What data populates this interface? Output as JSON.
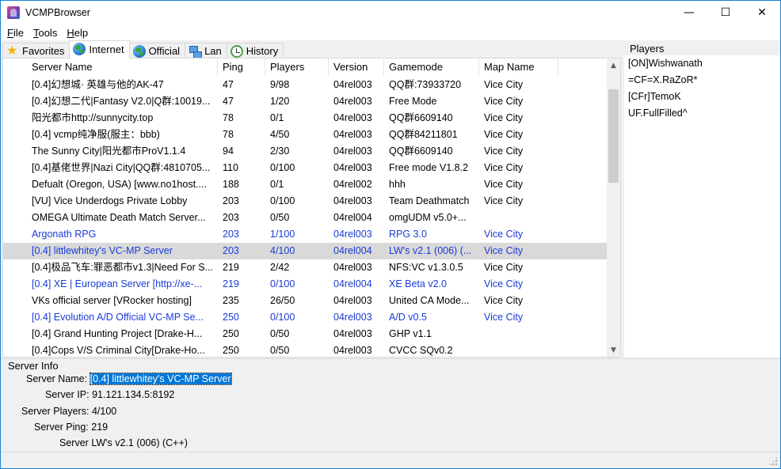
{
  "window": {
    "title": "VCMPBrowser",
    "controls": {
      "minimize": "—",
      "maximize": "☐",
      "close": "✕"
    }
  },
  "menu": {
    "items": [
      {
        "first": "F",
        "rest": "ile"
      },
      {
        "first": "T",
        "rest": "ools"
      },
      {
        "first": "H",
        "rest": "elp"
      }
    ]
  },
  "tabs": [
    {
      "label": "Favorites",
      "icon": "star-icon"
    },
    {
      "label": "Internet",
      "icon": "globe-icon",
      "active": true
    },
    {
      "label": "Official",
      "icon": "globe-icon"
    },
    {
      "label": "Lan",
      "icon": "lan-icon"
    },
    {
      "label": "History",
      "icon": "history-icon"
    }
  ],
  "server_list": {
    "columns": [
      "Server Name",
      "Ping",
      "Players",
      "Version",
      "Gamemode",
      "Map Name"
    ],
    "rows": [
      {
        "name": "[0.4]幻想城·      英雄与他的AK-47",
        "ping": "47",
        "players": "9/98",
        "version": "04rel003",
        "gamemode": "QQ群:73933720",
        "map": "Vice City",
        "blue": false
      },
      {
        "name": "[0.4]幻想二代|Fantasy V2.0|Q群:10019...",
        "ping": "47",
        "players": "1/20",
        "version": "04rel003",
        "gamemode": "Free Mode",
        "map": "Vice City",
        "blue": false
      },
      {
        "name": "阳光都市http://sunnycity.top",
        "ping": "78",
        "players": "0/1",
        "version": "04rel003",
        "gamemode": "QQ群6609140",
        "map": "Vice City",
        "blue": false
      },
      {
        "name": "[0.4] vcmp纯净服(服主：bbb)",
        "ping": "78",
        "players": "4/50",
        "version": "04rel003",
        "gamemode": "QQ群84211801",
        "map": "Vice City",
        "blue": false
      },
      {
        "name": "The Sunny City|阳光都市ProV1.1.4",
        "ping": "94",
        "players": "2/30",
        "version": "04rel003",
        "gamemode": "QQ群6609140",
        "map": "Vice City",
        "blue": false
      },
      {
        "name": "[0.4]基佬世界|Nazi City|QQ群:4810705...",
        "ping": "110",
        "players": "0/100",
        "version": "04rel003",
        "gamemode": "Free mode V1.8.2",
        "map": "Vice City",
        "blue": false
      },
      {
        "name": "Defualt (Oregon, USA) [www.no1host....",
        "ping": "188",
        "players": "0/1",
        "version": "04rel002",
        "gamemode": "hhh",
        "map": "Vice City",
        "blue": false
      },
      {
        "name": "[VU] Vice Underdogs Private Lobby",
        "ping": "203",
        "players": "0/100",
        "version": "04rel003",
        "gamemode": "Team Deathmatch",
        "map": "Vice City",
        "blue": false
      },
      {
        "name": "OMEGA Ultimate Death Match Server...",
        "ping": "203",
        "players": "0/50",
        "version": "04rel004",
        "gamemode": "omgUDM v5.0+...",
        "map": "",
        "blue": false
      },
      {
        "name": "Argonath RPG",
        "ping": "203",
        "players": "1/100",
        "version": "04rel003",
        "gamemode": "RPG 3.0",
        "map": "Vice City",
        "blue": true
      },
      {
        "name": "[0.4] littlewhitey's VC-MP Server",
        "ping": "203",
        "players": "4/100",
        "version": "04rel004",
        "gamemode": "LW's v2.1 (006) (...",
        "map": "Vice City",
        "blue": true,
        "selected": true
      },
      {
        "name": "[0.4]极品飞车:罪恶都市v1.3|Need For S...",
        "ping": "219",
        "players": "2/42",
        "version": "04rel003",
        "gamemode": "NFS:VC v1.3.0.5",
        "map": "Vice City",
        "blue": false
      },
      {
        "name": "[0.4] XE | European Server [http://xe-...",
        "ping": "219",
        "players": "0/100",
        "version": "04rel004",
        "gamemode": "XE Beta v2.0",
        "map": "Vice City",
        "blue": true
      },
      {
        "name": "VKs official server [VRocker hosting]",
        "ping": "235",
        "players": "26/50",
        "version": "04rel003",
        "gamemode": "United CA Mode...",
        "map": "Vice City",
        "blue": false
      },
      {
        "name": "[0.4] Evolution A/D Official VC-MP Se...",
        "ping": "250",
        "players": "0/100",
        "version": "04rel003",
        "gamemode": "A/D v0.5",
        "map": "Vice City",
        "blue": true
      },
      {
        "name": "[0.4] Grand Hunting Project [Drake-H...",
        "ping": "250",
        "players": "0/50",
        "version": "04rel003",
        "gamemode": "GHP v1.1",
        "map": "",
        "blue": false
      },
      {
        "name": "[0.4]Cops V/S Criminal City[Drake-Ho...",
        "ping": "250",
        "players": "0/50",
        "version": "04rel003",
        "gamemode": "CVCC SQv0.2",
        "map": "",
        "blue": false
      }
    ]
  },
  "players": {
    "title": "Players",
    "items": [
      "[ON]Wishwanath",
      "=CF=X.RaZoR*",
      "[CFr]TemoK",
      "UF.FullFilled^"
    ]
  },
  "server_info": {
    "title": "Server Info",
    "name_label": "Server Name:",
    "name_value": "[0.4] littlewhitey's VC-MP Server",
    "ip_label": "Server IP:",
    "ip_value": "91.121.134.5:8192",
    "players_label": "Server Players:",
    "players_value": "4/100",
    "ping_label": "Server Ping:",
    "ping_value": "219",
    "gamemode_label": "Server",
    "gamemode_value": "LW's v2.1 (006) (C++)"
  },
  "colors": {
    "accent": "#0078d7",
    "highlight_text": "#1a3bd6",
    "selected_row": "#d9d9d9"
  }
}
